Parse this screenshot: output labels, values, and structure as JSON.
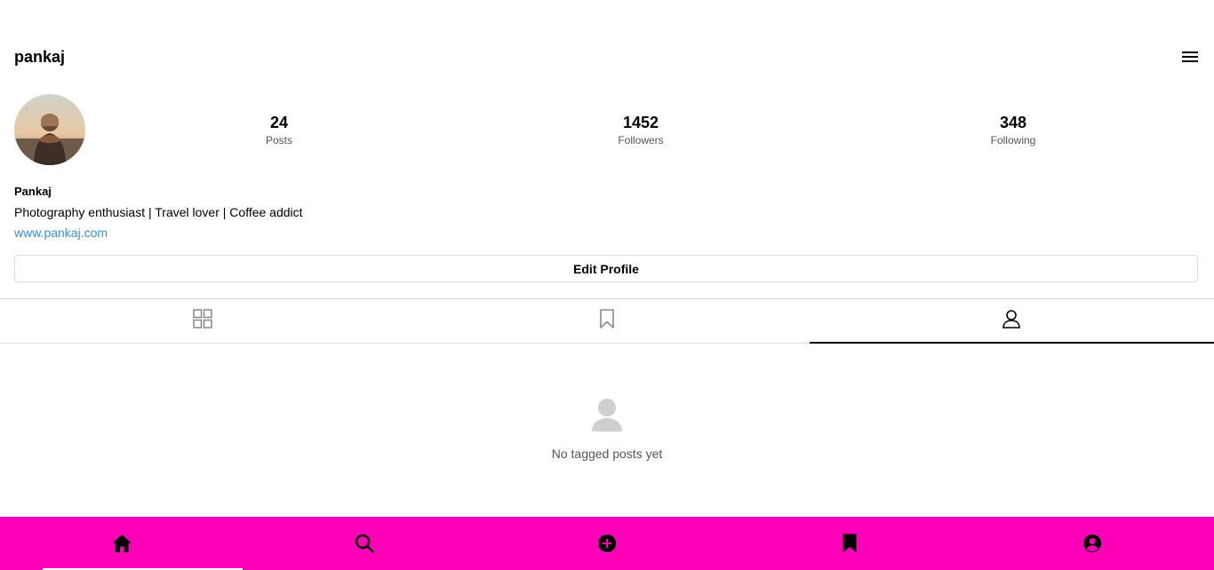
{
  "header": {
    "username": "pankaj",
    "menu_icon": "hamburger-menu-icon"
  },
  "profile": {
    "avatar_icon": "profile-photo",
    "stats": [
      {
        "value": "24",
        "label": "Posts"
      },
      {
        "value": "1452",
        "label": "Followers"
      },
      {
        "value": "348",
        "label": "Following"
      }
    ],
    "name": "Pankaj",
    "bio": "Photography enthusiast | Travel lover | Coffee addict",
    "website": "www.pankaj.com",
    "edit_button_label": "Edit Profile"
  },
  "tabs": [
    {
      "icon": "grid-icon",
      "active": false
    },
    {
      "icon": "bookmark-icon",
      "active": false
    },
    {
      "icon": "tagged-user-icon",
      "active": true
    }
  ],
  "empty_state": {
    "icon": "user-placeholder-icon",
    "message": "No tagged posts yet"
  },
  "bottom_nav": {
    "background_color": "#ff00b8",
    "items": [
      {
        "icon": "home-icon"
      },
      {
        "icon": "search-icon"
      },
      {
        "icon": "add-post-icon"
      },
      {
        "icon": "bookmark-icon"
      },
      {
        "icon": "profile-icon"
      }
    ]
  },
  "colors": {
    "link": "#3a8fd9",
    "border": "#dbdbdb",
    "accent": "#ff00b8"
  }
}
